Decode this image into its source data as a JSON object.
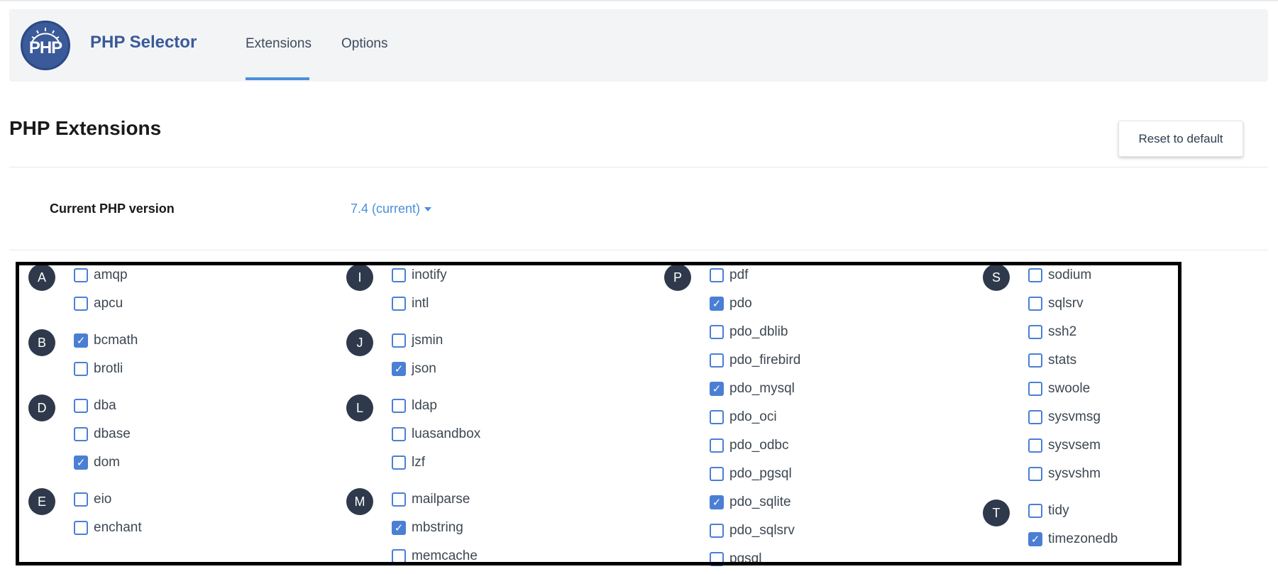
{
  "header": {
    "logo_text": "PHP",
    "app_title": "PHP Selector",
    "tabs": [
      {
        "label": "Extensions",
        "active": true
      },
      {
        "label": "Options",
        "active": false
      }
    ]
  },
  "page": {
    "title": "PHP Extensions",
    "reset_label": "Reset to default"
  },
  "version": {
    "label": "Current PHP version",
    "value": "7.4 (current)"
  },
  "colors": {
    "accent": "#4a90d9",
    "brand": "#3a5a99",
    "letter_badge": "#2e3a4b",
    "checkbox": "#4a7fd4"
  },
  "columns": [
    [
      {
        "letter": "A",
        "items": [
          {
            "name": "amqp",
            "checked": false
          },
          {
            "name": "apcu",
            "checked": false
          }
        ]
      },
      {
        "letter": "B",
        "items": [
          {
            "name": "bcmath",
            "checked": true
          },
          {
            "name": "brotli",
            "checked": false
          }
        ]
      },
      {
        "letter": "D",
        "items": [
          {
            "name": "dba",
            "checked": false
          },
          {
            "name": "dbase",
            "checked": false
          },
          {
            "name": "dom",
            "checked": true
          }
        ]
      },
      {
        "letter": "E",
        "items": [
          {
            "name": "eio",
            "checked": false
          },
          {
            "name": "enchant",
            "checked": false
          }
        ]
      }
    ],
    [
      {
        "letter": "I",
        "items": [
          {
            "name": "inotify",
            "checked": false
          },
          {
            "name": "intl",
            "checked": false
          }
        ]
      },
      {
        "letter": "J",
        "items": [
          {
            "name": "jsmin",
            "checked": false
          },
          {
            "name": "json",
            "checked": true
          }
        ]
      },
      {
        "letter": "L",
        "items": [
          {
            "name": "ldap",
            "checked": false
          },
          {
            "name": "luasandbox",
            "checked": false
          },
          {
            "name": "lzf",
            "checked": false
          }
        ]
      },
      {
        "letter": "M",
        "items": [
          {
            "name": "mailparse",
            "checked": false
          },
          {
            "name": "mbstring",
            "checked": true
          },
          {
            "name": "memcache",
            "checked": false
          }
        ]
      }
    ],
    [
      {
        "letter": "P",
        "items": [
          {
            "name": "pdf",
            "checked": false
          },
          {
            "name": "pdo",
            "checked": true
          },
          {
            "name": "pdo_dblib",
            "checked": false
          },
          {
            "name": "pdo_firebird",
            "checked": false
          },
          {
            "name": "pdo_mysql",
            "checked": true
          },
          {
            "name": "pdo_oci",
            "checked": false
          },
          {
            "name": "pdo_odbc",
            "checked": false
          },
          {
            "name": "pdo_pgsql",
            "checked": false
          },
          {
            "name": "pdo_sqlite",
            "checked": true
          },
          {
            "name": "pdo_sqlsrv",
            "checked": false
          },
          {
            "name": "pgsql",
            "checked": false
          }
        ]
      }
    ],
    [
      {
        "letter": "S",
        "items": [
          {
            "name": "sodium",
            "checked": false
          },
          {
            "name": "sqlsrv",
            "checked": false
          },
          {
            "name": "ssh2",
            "checked": false
          },
          {
            "name": "stats",
            "checked": false
          },
          {
            "name": "swoole",
            "checked": false
          },
          {
            "name": "sysvmsg",
            "checked": false
          },
          {
            "name": "sysvsem",
            "checked": false
          },
          {
            "name": "sysvshm",
            "checked": false
          }
        ]
      },
      {
        "letter": "T",
        "items": [
          {
            "name": "tidy",
            "checked": false
          },
          {
            "name": "timezonedb",
            "checked": true
          }
        ]
      }
    ]
  ]
}
